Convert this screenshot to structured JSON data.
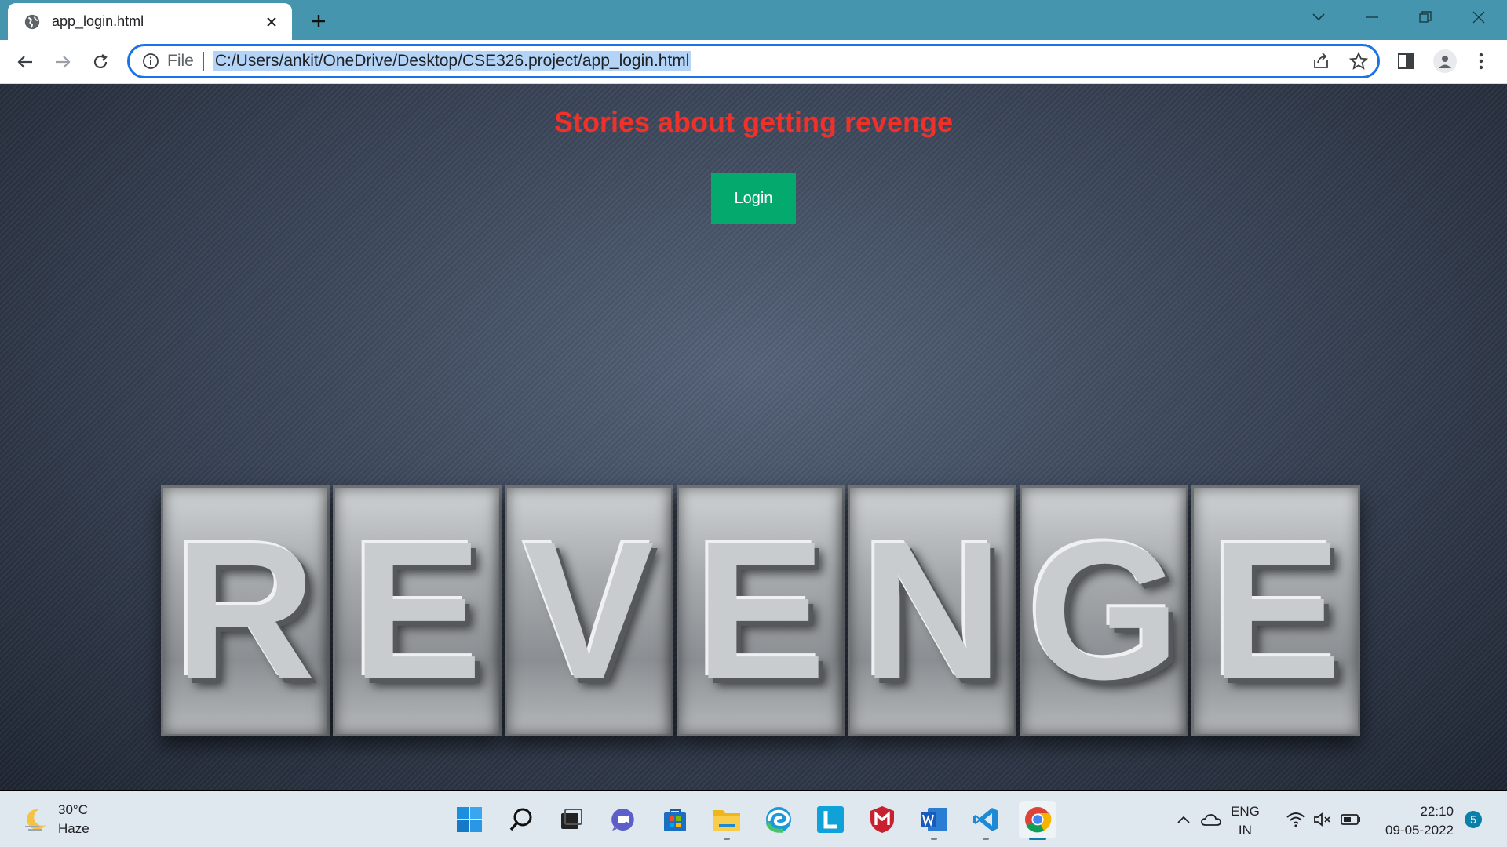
{
  "browser": {
    "tab": {
      "title": "app_login.html"
    },
    "address": {
      "scheme_label": "File",
      "url": "C:/Users/ankit/OneDrive/Desktop/CSE326.project/app_login.html"
    }
  },
  "page": {
    "headline": "Stories about getting revenge",
    "login_label": "Login",
    "hero_letters": [
      "R",
      "E",
      "V",
      "E",
      "N",
      "G",
      "E"
    ]
  },
  "taskbar": {
    "weather": {
      "temp": "30°C",
      "condition": "Haze"
    },
    "language": {
      "line1": "ENG",
      "line2": "IN"
    },
    "clock": {
      "time": "22:10",
      "date": "09-05-2022"
    },
    "notifications": "5"
  },
  "colors": {
    "accent": "#1a73e8",
    "tabstrip": "#4495ad",
    "headline": "#f0312a",
    "button": "#04aa6d"
  }
}
